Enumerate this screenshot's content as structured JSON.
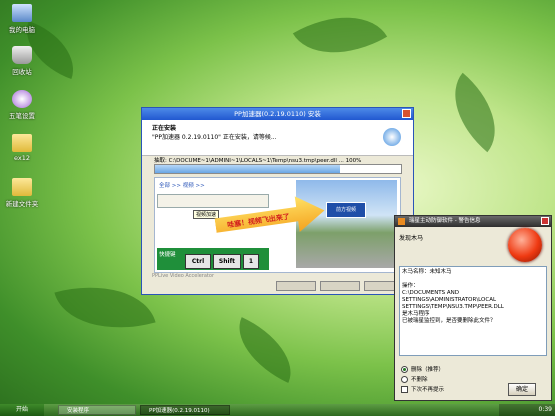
{
  "desktop": {
    "icons": [
      {
        "label": "我的电脑",
        "icon": "my-computer-icon"
      },
      {
        "label": "回收站",
        "icon": "recycle-bin-icon"
      },
      {
        "label": "五笔设置",
        "icon": "input-method-icon"
      },
      {
        "label": "ex12",
        "icon": "folder-icon"
      },
      {
        "label": "新建文件夹",
        "icon": "folder-icon"
      }
    ]
  },
  "installer": {
    "title": "PP加速器(0.2.19.0110) 安装",
    "heading": "正在安装",
    "subheading": "\"PP加速器 0.2.19.0110\" 正在安装，请等候...",
    "detail": "抽取: C:\\DOCUME~1\\ADMINI~1\\LOCALS~1\\Temp\\nsu3.tmp\\peer.dll ... 100%",
    "progress": 0.75,
    "banner": {
      "nav": "全部 >> 视频 >>",
      "tooltip": "视频加速",
      "slogan": "哇塞！视频飞出来了",
      "sign_text": "前方视频",
      "keys_label": "快捷键",
      "keys": [
        "Ctrl",
        "Shift",
        "1"
      ]
    },
    "brand": "PPLive Video Accelerator"
  },
  "notify": {
    "title": "瑞星主动防御软件 - 警告信息",
    "subtitle": "发现木马",
    "lines": [
      "木马名称：未知木马",
      "",
      "操作：",
      "C:\\DOCUMENTS AND",
      "SETTINGS\\ADMINISTRATOR\\LOCAL",
      "SETTINGS\\TEMP\\NSU3.TMP\\PEER.DLL",
      "是木马程序",
      "已被瑞星监控到，是否要删除此文件？"
    ],
    "options": [
      {
        "label": "删除（推荐）",
        "type": "radio",
        "checked": true
      },
      {
        "label": "不删除",
        "type": "radio",
        "checked": false
      },
      {
        "label": "下次不再提示",
        "type": "checkbox",
        "checked": false
      }
    ],
    "ok_label": "确定"
  },
  "taskbar": {
    "start": "开始",
    "tasks": [
      "安装程序",
      "PP加速器(0.2.19.0110)"
    ],
    "clock": "0:39"
  }
}
